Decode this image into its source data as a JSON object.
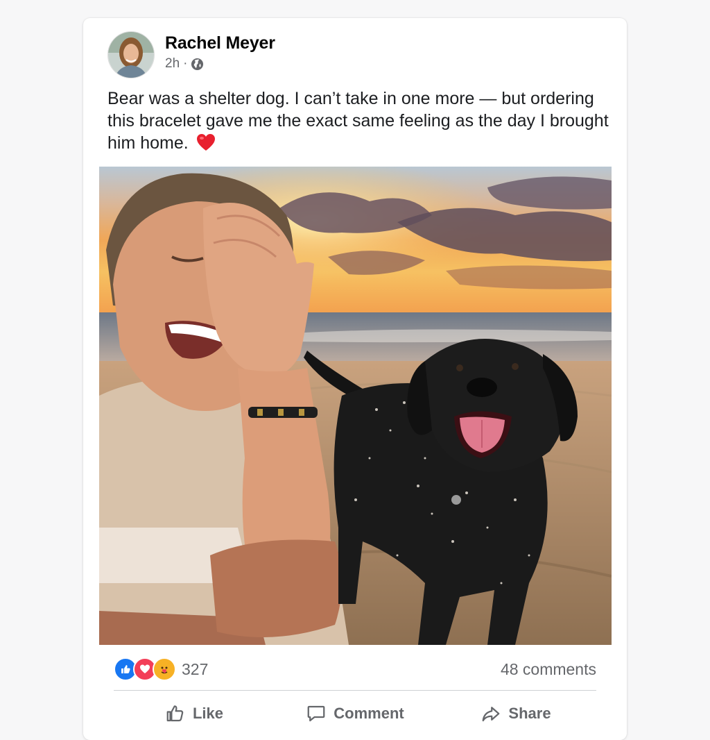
{
  "post": {
    "author": "Rachel Meyer",
    "time": "2h",
    "separator": "·",
    "privacy_icon": "globe-icon",
    "text": "Bear was a shelter dog. I can’t take in one more — but ordering this bracelet gave me the exact same feeling as the day I brought him home.",
    "emoji": "red-heart"
  },
  "reactions": {
    "icons": [
      "like-reaction",
      "love-reaction",
      "care-reaction"
    ],
    "count": "327",
    "comments": "48 comments"
  },
  "actions": {
    "like": "Like",
    "comment": "Comment",
    "share": "Share"
  },
  "colors": {
    "like_blue": "#1877f2",
    "love_red": "#f33e58",
    "care_yellow": "#f7b125",
    "muted_text": "#65676b"
  }
}
